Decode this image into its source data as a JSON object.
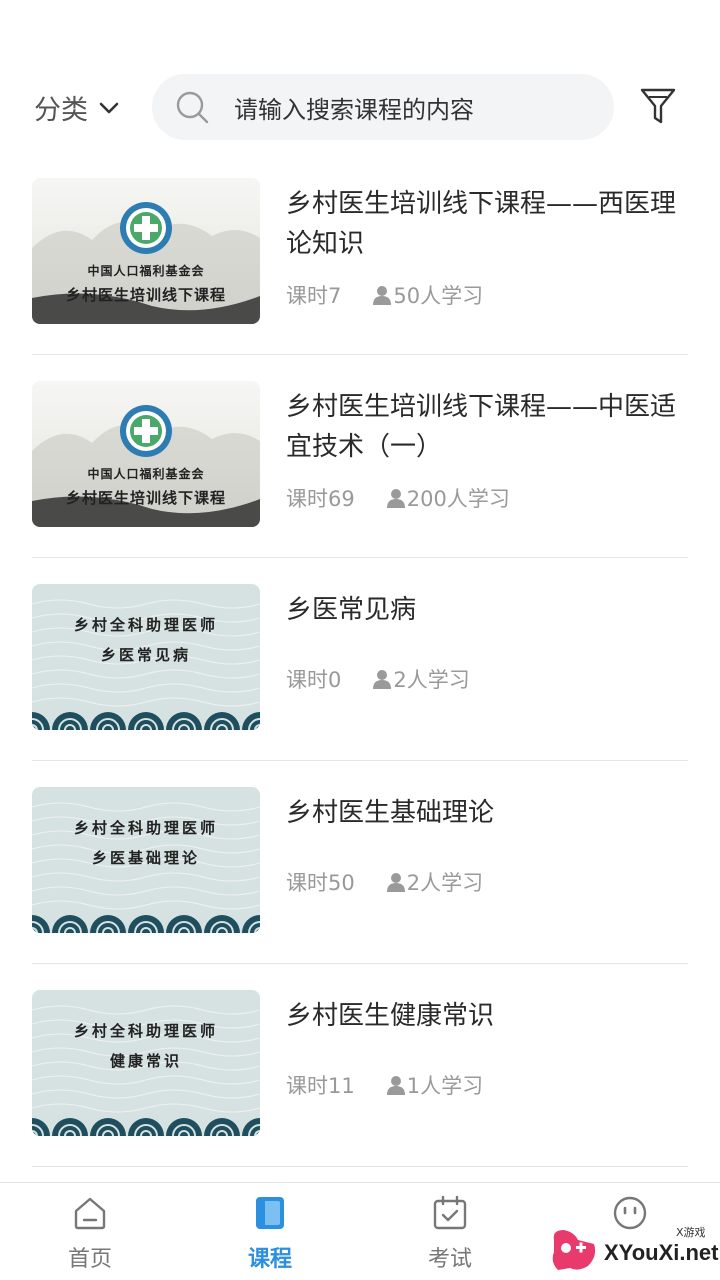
{
  "header": {
    "category_label": "分类",
    "search_placeholder": "请输入搜索课程的内容"
  },
  "courses": [
    {
      "title": "乡村医生培训线下课程——西医理论知识",
      "hours": "课时7",
      "learners": "50人学习",
      "thumb_style": "ink",
      "thumb_line1": "中国人口福利基金会",
      "thumb_line2": "乡村医生培训线下课程"
    },
    {
      "title": "乡村医生培训线下课程——中医适宜技术（一）",
      "hours": "课时69",
      "learners": "200人学习",
      "thumb_style": "ink",
      "thumb_line1": "中国人口福利基金会",
      "thumb_line2": "乡村医生培训线下课程"
    },
    {
      "title": "乡医常见病",
      "hours": "课时0",
      "learners": "2人学习",
      "thumb_style": "wave",
      "thumb_line1": "乡村全科助理医师",
      "thumb_line2": "乡医常见病"
    },
    {
      "title": "乡村医生基础理论",
      "hours": "课时50",
      "learners": "2人学习",
      "thumb_style": "wave",
      "thumb_line1": "乡村全科助理医师",
      "thumb_line2": "乡医基础理论"
    },
    {
      "title": "乡村医生健康常识",
      "hours": "课时11",
      "learners": "1人学习",
      "thumb_style": "wave",
      "thumb_line1": "乡村全科助理医师",
      "thumb_line2": "健康常识"
    }
  ],
  "nav": {
    "home": "首页",
    "courses": "课程",
    "exam": "考试"
  },
  "watermark": {
    "text": "XYouXi.net",
    "small": "X游戏"
  },
  "colors": {
    "accent": "#2c8fe0",
    "text_muted": "#999999",
    "search_bg": "#f3f4f6",
    "wave_bg": "#d6e2e1",
    "wave_dark": "#1f4f5e"
  }
}
